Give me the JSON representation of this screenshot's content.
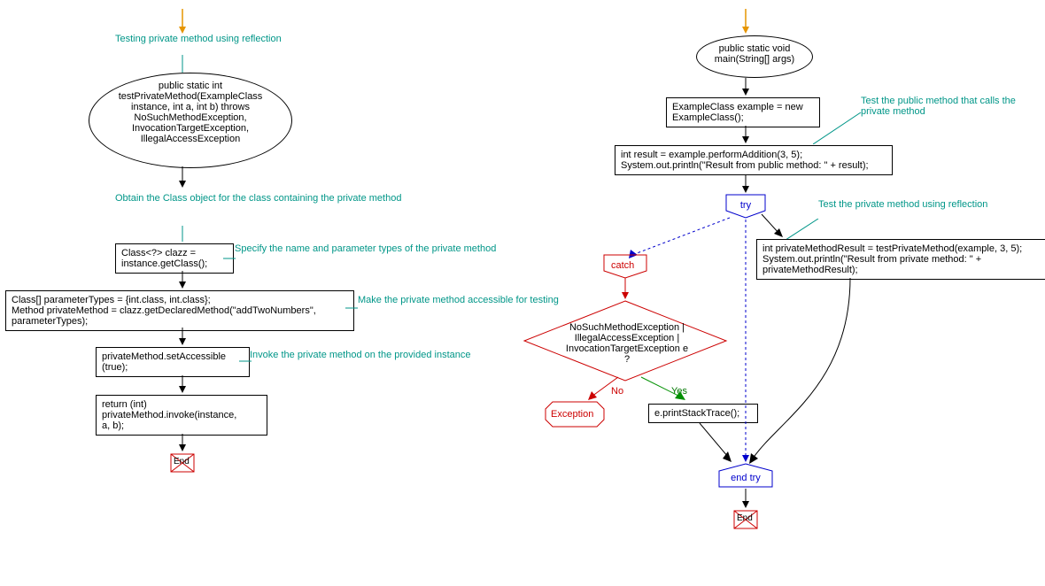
{
  "left": {
    "comment_top": "Testing private method\nusing reflection",
    "ellipse": "public static int\ntestPrivateMethod(ExampleClass\ninstance, int a, int b)\nthrows NoSuchMethodException,\nInvocationTargetException,\nIllegalAccessException",
    "comment_obtain": "Obtain the Class object\nfor the class containing\nthe private method",
    "box_clazz": "Class<?> clazz =\ninstance.getClass();",
    "comment_specify": "Specify the name and\nparameter types of the\nprivate method",
    "box_paramtypes": "Class[] parameterTypes = {int.class, int.class};\nMethod privateMethod = clazz.getDeclaredMethod(\"addTwoNumbers\",\nparameterTypes);",
    "comment_accessible": "Make the private method\naccessible for testing",
    "box_setaccess": "privateMethod.setAccessible\n(true);",
    "comment_invoke": "Invoke the private method\non the provided instance",
    "box_invoke": "return (int)\nprivateMethod.invoke(instance,\na, b);",
    "end": "End"
  },
  "right": {
    "ellipse": "public static void\nmain(String[] args)",
    "box_example": "ExampleClass example = new\nExampleClass();",
    "comment_testpublic": "Test the public method\nthat calls the private\nmethod",
    "box_result": "int result = example.performAddition(3, 5);\nSystem.out.println(\"Result from public method: \" + result);",
    "try": "try",
    "comment_testprivate": "Test the private method\nusing reflection",
    "box_privresult": "int privateMethodResult = testPrivateMethod(example, 3, 5);\nSystem.out.println(\"Result from private method: \" +\nprivateMethodResult);",
    "catch": "catch",
    "decision": "NoSuchMethodException |\nIllegalAccessException |\nInvocationTargetException e ?",
    "yes": "Yes",
    "no": "No",
    "exception": "Exception",
    "box_printstack": "e.printStackTrace();",
    "endtry": "end try",
    "end": "End"
  }
}
